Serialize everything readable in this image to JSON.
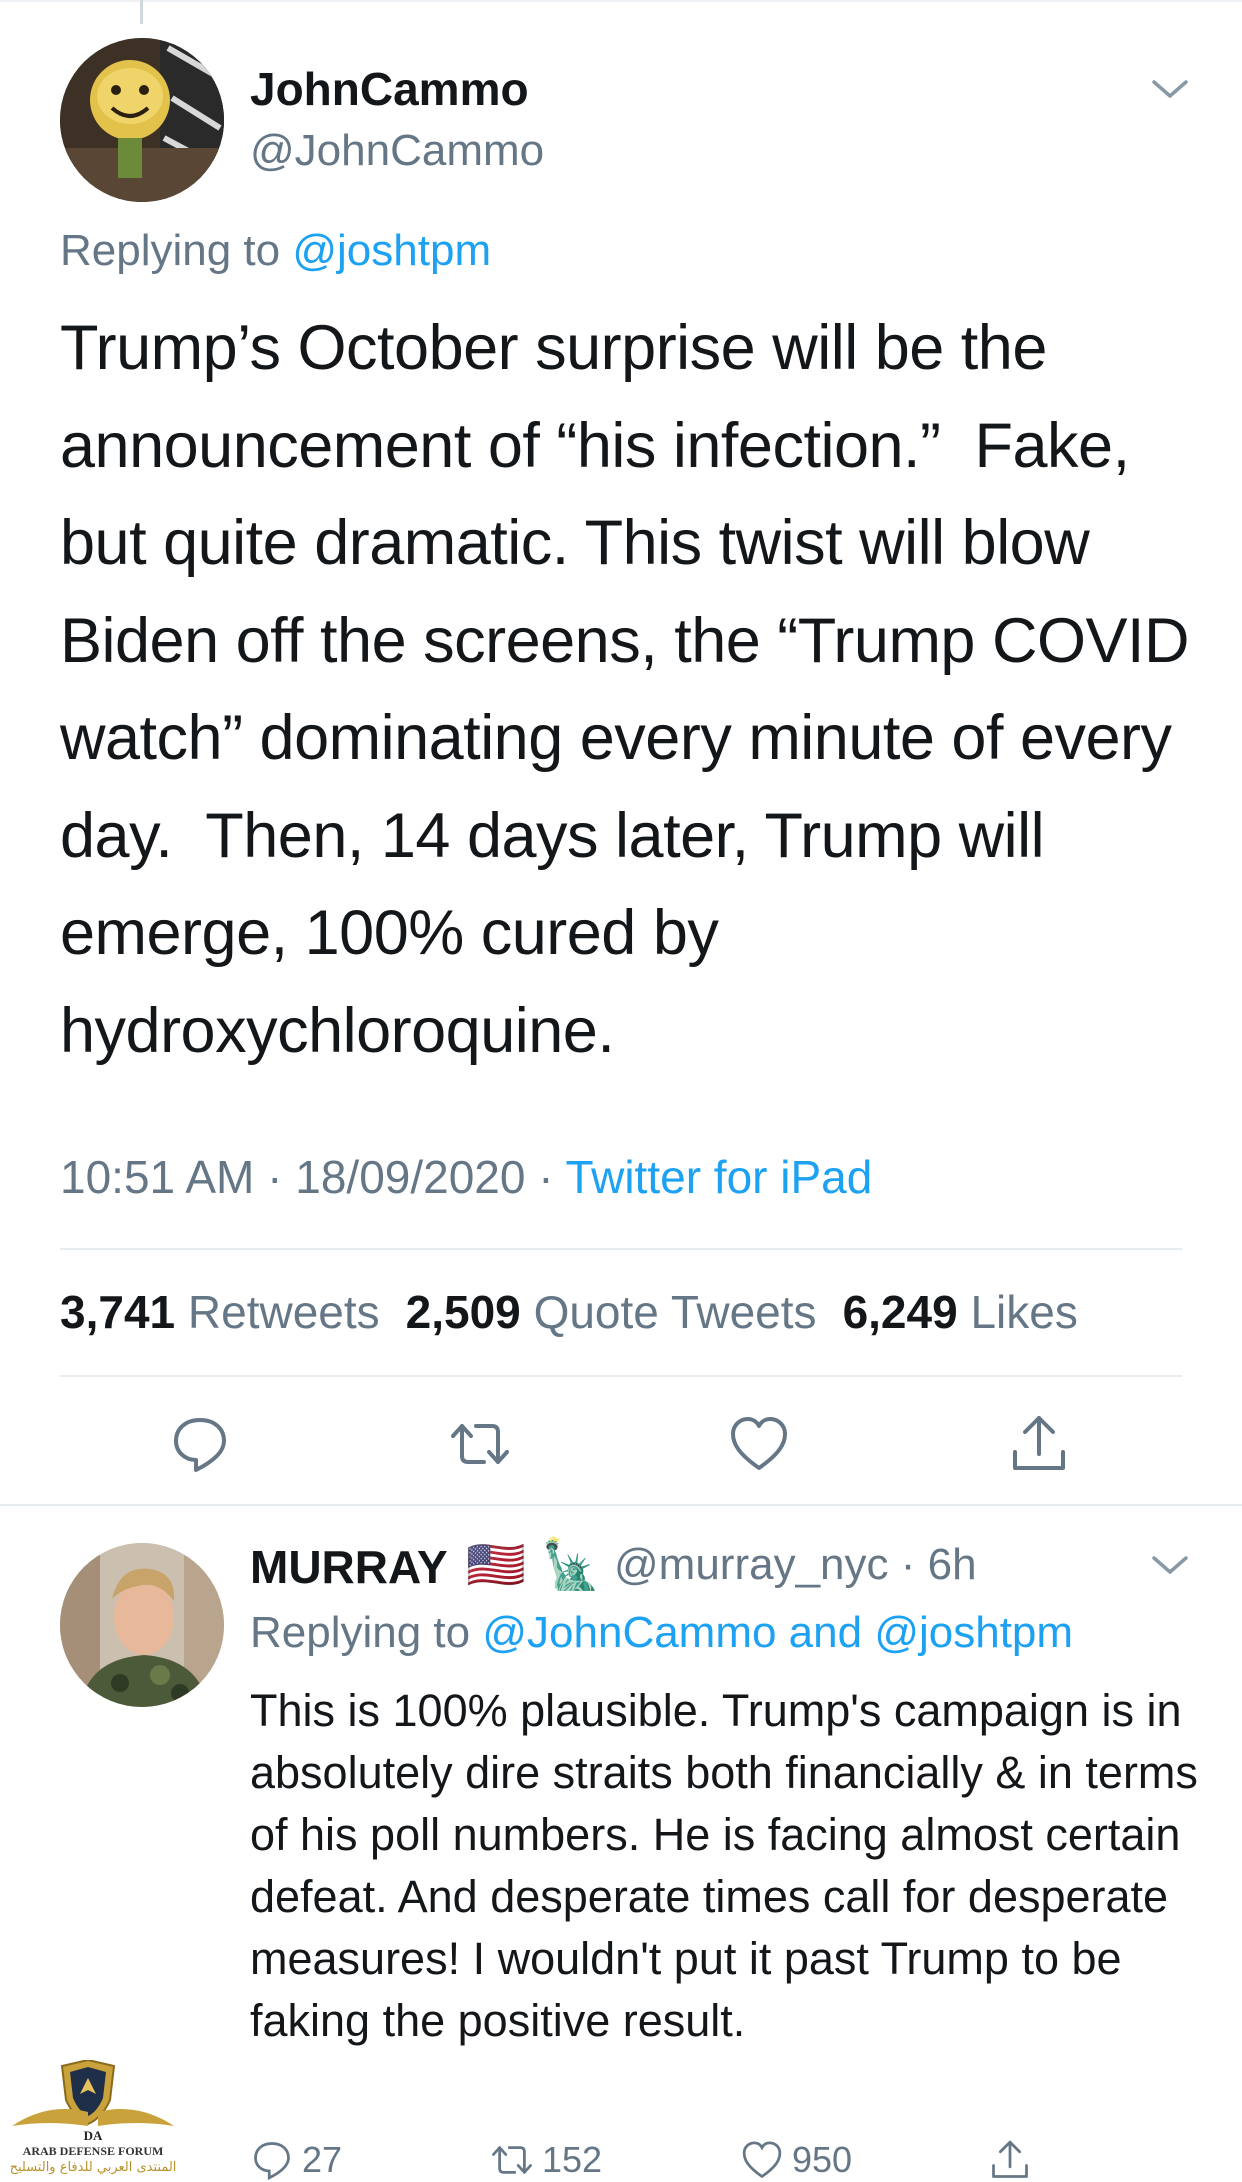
{
  "main_tweet": {
    "display_name": "JohnCammo",
    "handle": "@JohnCammo",
    "replying_prefix": "Replying to ",
    "replying_to": "@joshtpm",
    "text": "Trump’s October surprise will be the announcement of “his infection.”  Fake, but quite dramatic. This twist will blow Biden off the screens, the “Trump COVID watch” dominating every minute of every day.  Then, 14 days later, Trump will emerge, 100% cured by hydroxychloroquine.",
    "time": "10:51 AM",
    "date": "18/09/2020",
    "source": "Twitter for iPad",
    "separator": " · ",
    "retweets_count": "3,741",
    "retweets_label": "Retweets",
    "quote_count": "2,509",
    "quote_label": "Quote Tweets",
    "likes_count": "6,249",
    "likes_label": "Likes"
  },
  "reply_tweet": {
    "display_name": "MURRAY",
    "emojis": "🇺🇸 🗽",
    "handle": "@murray_nyc",
    "time": "6h",
    "separator": " · ",
    "replying_prefix": "Replying to ",
    "replying_to": "@JohnCammo and @joshtpm",
    "text": "This is 100% plausible. Trump's campaign is in absolutely dire straits both financially & in terms of his poll numbers. He is facing almost certain defeat. And desperate times call for desperate measures! I wouldn't put it past Trump to be faking the positive result.",
    "reply_count": "27",
    "retweet_count": "152",
    "like_count": "950"
  },
  "watermark": {
    "line1": "ARAB DEFENSE FORUM",
    "line2": "المنتدى العربي للدفاع والتسليح",
    "logo_letters": "DA"
  },
  "icons": {
    "reply": "reply-icon",
    "retweet": "retweet-icon",
    "like": "heart-icon",
    "share": "share-icon",
    "menu": "chevron-down-icon"
  },
  "colors": {
    "link": "#1da1f2",
    "secondary_text": "#657786",
    "primary_text": "#14171a",
    "divider": "#e6ecf0"
  }
}
